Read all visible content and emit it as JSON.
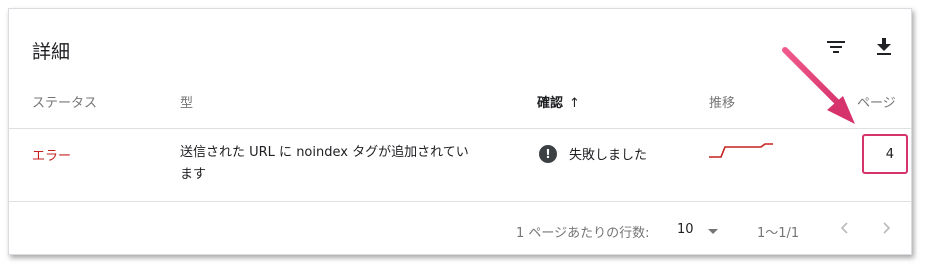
{
  "card": {
    "title": "詳細",
    "filter_icon": "filter-icon",
    "download_icon": "download-icon"
  },
  "table": {
    "headers": {
      "status": "ステータス",
      "type": "型",
      "validation": "確認",
      "trend": "推移",
      "pages": "ページ"
    },
    "sort": {
      "column": "validation",
      "direction": "ascending",
      "icon": "arrow-up-icon"
    },
    "rows": [
      {
        "status": "エラー",
        "type_line1": "送信された URL に noindex タグが追加されてい",
        "type_line2": "ます",
        "validation": "失敗しました",
        "validation_icon": "exclamation-icon",
        "pages": "4"
      }
    ]
  },
  "pagination": {
    "rows_per_page_label": "1 ページあたりの行数:",
    "rows_per_page_value": "10",
    "range": "1〜1/1",
    "prev_icon": "chevron-left-icon",
    "next_icon": "chevron-right-icon"
  },
  "colors": {
    "error": "#c5221f",
    "annotation": "#d6336c",
    "muted": "#757575"
  }
}
